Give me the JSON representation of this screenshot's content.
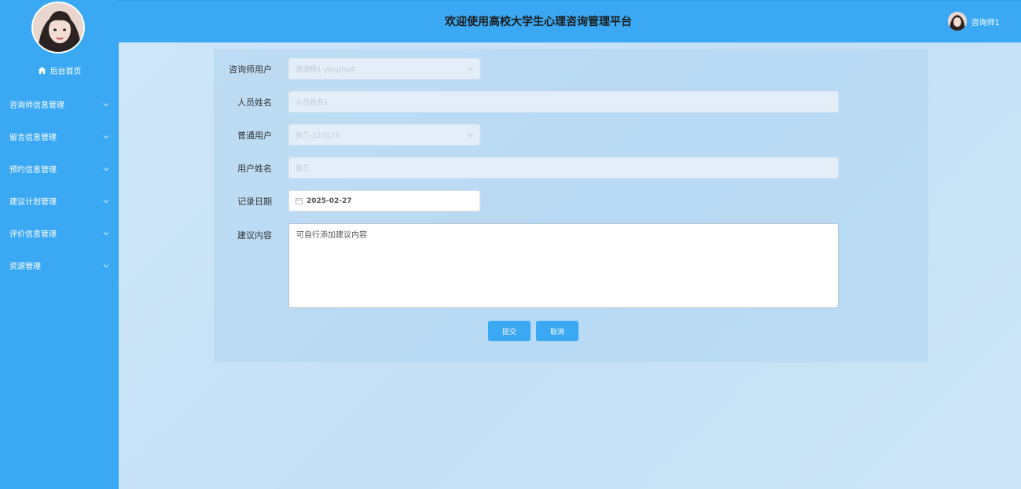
{
  "header": {
    "title": "欢迎使用高校大学生心理咨询管理平台",
    "username": "咨询师1"
  },
  "sidebar": {
    "home_label": "后台首页",
    "items": [
      {
        "label": "咨询师信息管理"
      },
      {
        "label": "留言信息管理"
      },
      {
        "label": "预约信息管理"
      },
      {
        "label": "建议计划管理"
      },
      {
        "label": "评价信息管理"
      },
      {
        "label": "资源管理"
      }
    ]
  },
  "form": {
    "counselor_user": {
      "label": "咨询师用户",
      "value": "咨询师1-yonghu4"
    },
    "staff_name": {
      "label": "人员姓名",
      "value": "人员姓名1"
    },
    "normal_user": {
      "label": "普通用户",
      "value": "张三-123123"
    },
    "user_name": {
      "label": "用户姓名",
      "value": "张三"
    },
    "record_date": {
      "label": "记录日期",
      "value": "2025-02-27"
    },
    "suggestion": {
      "label": "建议内容",
      "value": "可自行添加建议内容"
    },
    "submit_label": "提交",
    "cancel_label": "取消"
  },
  "colors": {
    "accent": "#3aa8f2",
    "background": "#c6e2f7"
  }
}
